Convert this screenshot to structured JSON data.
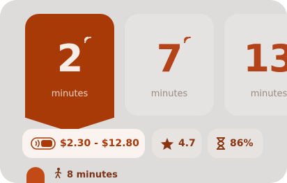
{
  "options": [
    {
      "value": "2",
      "unit": "minutes",
      "selected": true
    },
    {
      "value": "7",
      "unit": "minutes",
      "selected": false
    },
    {
      "value": "13",
      "unit": "minutes",
      "selected": false
    }
  ],
  "price_chip": {
    "label": "$2.30 - $12.80",
    "icon": "contactless-payment-icon"
  },
  "rating_chip": {
    "label": "4.7",
    "icon": "star-icon"
  },
  "percent_chip": {
    "label": "86%",
    "icon": "hourglass-icon"
  },
  "walk": {
    "label": "8 minutes",
    "icon": "walking-person-icon"
  },
  "colors": {
    "accent": "#a83a08",
    "background": "#dddcda",
    "card": "#e5e3e1"
  }
}
